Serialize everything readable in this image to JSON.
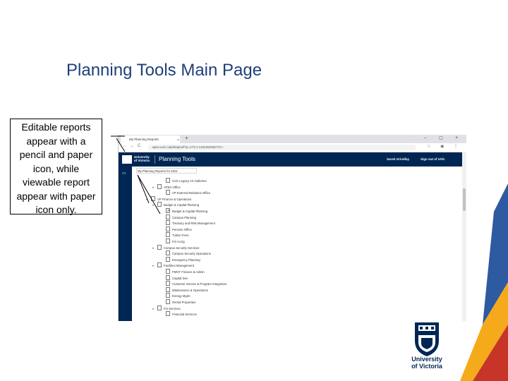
{
  "slide": {
    "title": "Planning Tools Main Page",
    "callout": "Editable reports appear with a pencil and paper icon, while viewable report appear with paper icon only."
  },
  "browser": {
    "tab_label": "My Planning Reports",
    "tab_close": "×",
    "tab_new": "+",
    "window_controls": "– ▢ ×",
    "nav_back": "←",
    "nav_forward": "→",
    "nav_reload": "C",
    "url": "apex.uvic.ca/pls/apex/f?p=173:1:1331932962721:::",
    "addr_right": "☆ ◉ ⋮"
  },
  "app": {
    "logo_text": "University\nof Victoria",
    "title": "Planning Tools",
    "user": "Sarah Grindlay",
    "signout": "Sign out of UVic"
  },
  "breadcrumb": "My Planning Reports for 2021",
  "tree": [
    {
      "label": "UVic Legacy Art Galleries",
      "level": 2,
      "expander": "",
      "editable": false
    },
    {
      "label": "VPEX Office",
      "level": 1,
      "expander": "▾",
      "editable": false
    },
    {
      "label": "VP External Relations Office",
      "level": 2,
      "expander": "",
      "editable": false
    },
    {
      "label": "VP Finance & Operations",
      "level": 0,
      "expander": "▾",
      "editable": false
    },
    {
      "label": "Budget & Capital Planning",
      "level": 1,
      "expander": "▾",
      "editable": false
    },
    {
      "label": "Budget & Capital Planning",
      "level": 2,
      "expander": "",
      "editable": true
    },
    {
      "label": "Campus Planning",
      "level": 2,
      "expander": "",
      "editable": false
    },
    {
      "label": "Treasury and Risk Management",
      "level": 2,
      "expander": "",
      "editable": false
    },
    {
      "label": "Pension Office",
      "level": 2,
      "expander": "",
      "editable": false
    },
    {
      "label": "Tuition Fees",
      "level": 2,
      "expander": "",
      "editable": false
    },
    {
      "label": "Fin Acctg",
      "level": 2,
      "expander": "",
      "editable": false
    },
    {
      "label": "Campus Security Services",
      "level": 1,
      "expander": "▾",
      "editable": false
    },
    {
      "label": "Campus Security Operations",
      "level": 2,
      "expander": "",
      "editable": false
    },
    {
      "label": "Emergency Planning",
      "level": 2,
      "expander": "",
      "editable": false
    },
    {
      "label": "Facilities Management",
      "level": 1,
      "expander": "▾",
      "editable": false
    },
    {
      "label": "FMGT Finance & Admin",
      "level": 2,
      "expander": "",
      "editable": false
    },
    {
      "label": "Capital Dev",
      "level": 2,
      "expander": "",
      "editable": false
    },
    {
      "label": "Customer Service & Program Integration",
      "level": 2,
      "expander": "",
      "editable": false
    },
    {
      "label": "Maintenance & Operations",
      "level": 2,
      "expander": "",
      "editable": false
    },
    {
      "label": "Energy Mgmt",
      "level": 2,
      "expander": "",
      "editable": false
    },
    {
      "label": "Rental Properties",
      "level": 2,
      "expander": "",
      "editable": false
    },
    {
      "label": "Fin Services",
      "level": 1,
      "expander": "▾",
      "editable": false
    },
    {
      "label": "Financial Services",
      "level": 2,
      "expander": "",
      "editable": false
    }
  ],
  "logo": {
    "line1": "University",
    "line2": "of Victoria"
  },
  "colors": {
    "brand_navy": "#002754",
    "title_blue": "#1f3f7a",
    "ribbon_blue": "#2d5aa0",
    "ribbon_yellow": "#f5aa1c",
    "ribbon_red": "#c63527"
  }
}
